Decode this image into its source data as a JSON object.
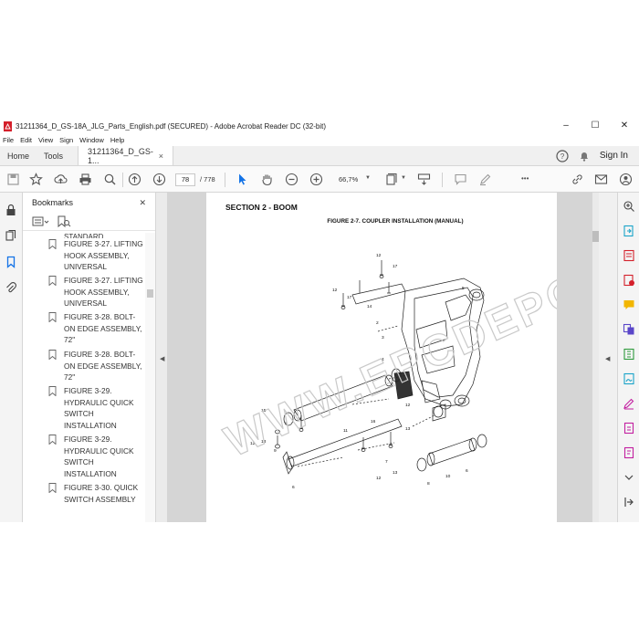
{
  "window": {
    "title": "31211364_D_GS-18A_JLG_Parts_English.pdf (SECURED) - Adobe Acrobat Reader DC (32-bit)",
    "minimize": "–",
    "maximize": "☐",
    "close": "✕"
  },
  "menu": [
    "File",
    "Edit",
    "View",
    "Sign",
    "Window",
    "Help"
  ],
  "tabs": {
    "home": "Home",
    "tools": "Tools",
    "document": "31211364_D_GS-1...",
    "document_close": "×",
    "sign_in": "Sign In"
  },
  "toolbar": {
    "page_current": "78",
    "page_total": "/ 778",
    "zoom": "66,7%",
    "more": "•••"
  },
  "bookmarks": {
    "title": "Bookmarks",
    "close": "✕",
    "clipped_text": "STANDARD",
    "items": [
      "FIGURE 3-27. LIFTING HOOK ASSEMBLY, UNIVERSAL",
      "FIGURE 3-27. LIFTING HOOK ASSEMBLY, UNIVERSAL",
      "FIGURE 3-28. BOLT-ON EDGE ASSEMBLY, 72\"",
      "FIGURE 3-28. BOLT-ON EDGE ASSEMBLY, 72\"",
      "FIGURE 3-29. HYDRAULIC QUICK SWITCH INSTALLATION",
      "FIGURE 3-29. HYDRAULIC QUICK SWITCH INSTALLATION",
      "FIGURE 3-30. QUICK SWITCH ASSEMBLY"
    ]
  },
  "document": {
    "section_title": "SECTION 2 - BOOM",
    "figure_title": "FIGURE 2-7. COUPLER INSTALLATION (MANUAL)",
    "watermark": "WWW.EPCDEPO.COM",
    "callouts": [
      "12",
      "17",
      "12",
      "17",
      "14",
      "5",
      "2",
      "15",
      "3",
      "2",
      "4",
      "16",
      "11",
      "12",
      "13",
      "9",
      "13",
      "12",
      "13",
      "8",
      "7",
      "10",
      "6",
      "6",
      "12"
    ]
  },
  "colors": {
    "accent_blue": "#1473e6",
    "toolbar_bg": "#fafafa",
    "doc_bg": "#d5d5d5",
    "pdf_red": "#d4202b"
  }
}
